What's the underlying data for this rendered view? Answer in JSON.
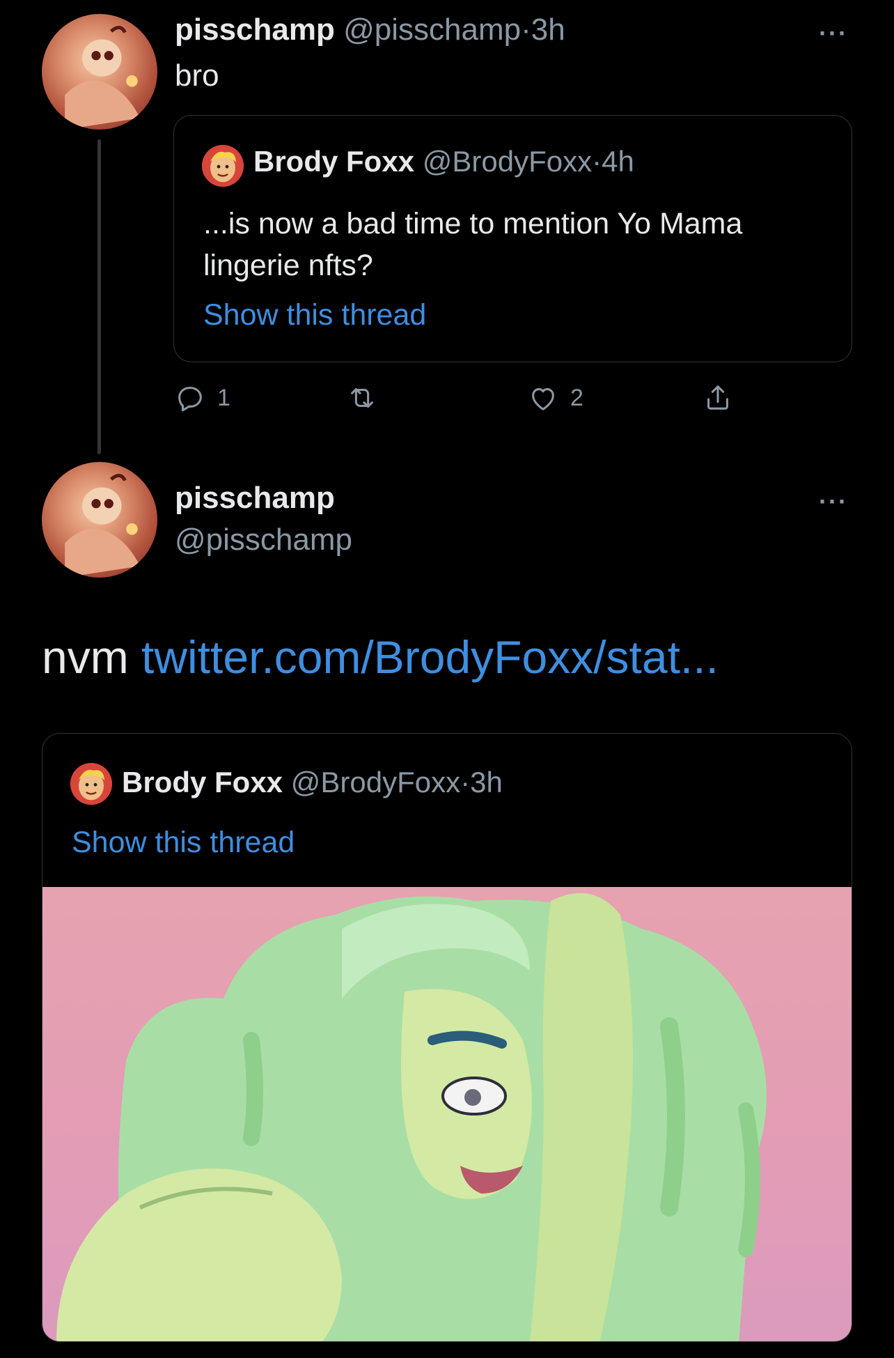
{
  "tweet1": {
    "display_name": "pisschamp",
    "handle": "@pisschamp",
    "separator": "·",
    "time": "3h",
    "text": "bro",
    "more": "···",
    "quote": {
      "display_name": "Brody Foxx",
      "handle": "@BrodyFoxx",
      "separator": "·",
      "time": "4h",
      "text": "...is now a bad time to mention Yo Mama lingerie nfts?",
      "show_thread": "Show this thread"
    },
    "actions": {
      "reply_count": "1",
      "retweet_count": "",
      "like_count": "2"
    },
    "icons": [
      "reply-icon",
      "retweet-icon",
      "like-icon",
      "share-icon"
    ]
  },
  "tweet2": {
    "display_name": "pisschamp",
    "handle": "@pisschamp",
    "more": "···",
    "text_prefix": "nvm",
    "text_link": "twitter.com/BrodyFoxx/stat...",
    "quote": {
      "display_name": "Brody Foxx",
      "handle": "@BrodyFoxx",
      "separator": "·",
      "time": "3h",
      "show_thread": "Show this thread"
    }
  },
  "colors": {
    "background": "#000000",
    "text": "#e7e9ea",
    "muted": "#8b98a5",
    "link": "#3f8ee0",
    "border": "#2f3336"
  }
}
